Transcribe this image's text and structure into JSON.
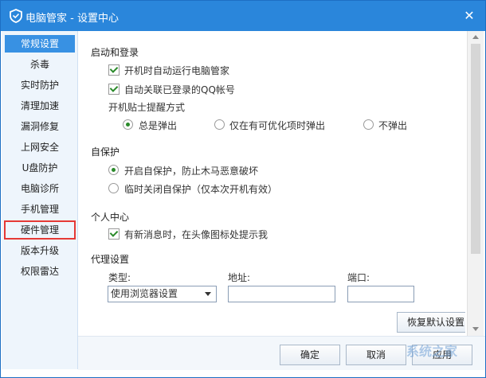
{
  "window": {
    "title": "电脑管家 - 设置中心",
    "close_glyph": "✕"
  },
  "sidebar": {
    "items": [
      {
        "label": "常规设置"
      },
      {
        "label": "杀毒"
      },
      {
        "label": "实时防护"
      },
      {
        "label": "清理加速"
      },
      {
        "label": "漏洞修复"
      },
      {
        "label": "上网安全"
      },
      {
        "label": "U盘防护"
      },
      {
        "label": "电脑诊所"
      },
      {
        "label": "手机管理"
      },
      {
        "label": "硬件管理"
      },
      {
        "label": "版本升级"
      },
      {
        "label": "权限雷达"
      }
    ],
    "active_index": 0,
    "highlighted_index": 9
  },
  "startup": {
    "heading": "启动和登录",
    "autorun_label": "开机时自动运行电脑管家",
    "autorun_checked": true,
    "link_qq_label": "自动关联已登录的QQ帐号",
    "link_qq_checked": true,
    "tip_mode_label": "开机贴士提醒方式",
    "tip_options": [
      "总是弹出",
      "仅在有可优化项时弹出",
      "不弹出"
    ],
    "tip_selected": 0
  },
  "selfprotect": {
    "heading": "自保护",
    "options": [
      "开启自保护，防止木马恶意破坏",
      "临时关闭自保护（仅本次开机有效）"
    ],
    "selected": 0
  },
  "personal": {
    "heading": "个人中心",
    "notify_label": "有新消息时，在头像图标处提示我",
    "notify_checked": true
  },
  "proxy": {
    "heading": "代理设置",
    "type_label": "类型:",
    "address_label": "地址:",
    "port_label": "端口:",
    "type_value": "使用浏览器设置",
    "address_value": "",
    "port_value": ""
  },
  "buttons": {
    "restore_default": "恢复默认设置",
    "ok": "确定",
    "cancel": "取消",
    "apply": "应用"
  },
  "colors": {
    "titlebar": "#2a86db",
    "active_item": "#3891e3",
    "highlight_border": "#e53935"
  },
  "watermark": "系统之家"
}
